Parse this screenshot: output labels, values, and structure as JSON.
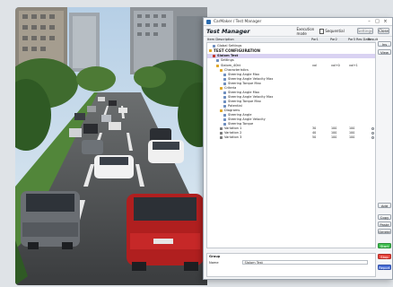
{
  "window": {
    "title": "CarMaker / Test Manager",
    "controls": {
      "minimize": "–",
      "maximize": "□",
      "close": "×"
    }
  },
  "header": {
    "title": "Test Manager",
    "execution_label": "Execution mode",
    "execution_value": "Sequential",
    "settings_label": "Settings",
    "close_label": "Close"
  },
  "columns": [
    "Item Description",
    "Par1",
    "Par2",
    "Par3",
    "Res Date",
    "Result"
  ],
  "tree": [
    {
      "label": "Global Settings",
      "indent": 1,
      "icon": "doc",
      "bold": false
    },
    {
      "label": "TEST CONFIGURATION",
      "indent": 0,
      "icon": "folder",
      "bold": true,
      "big": true
    },
    {
      "label": "Slalom Test",
      "indent": 1,
      "icon": "test",
      "bold": true,
      "selected": true
    },
    {
      "label": "Settings",
      "indent": 2,
      "icon": "doc",
      "bold": false
    },
    {
      "label": "Slalom_40kt",
      "indent": 2,
      "icon": "folder",
      "bold": false,
      "vals": [
        "val",
        "val+0",
        "val+1"
      ]
    },
    {
      "label": "Characteristics",
      "indent": 3,
      "icon": "folder",
      "bold": false
    },
    {
      "label": "Steering Angle Max",
      "indent": 4,
      "icon": "doc",
      "bold": false
    },
    {
      "label": "Steering Angle Velocity Max",
      "indent": 4,
      "icon": "doc",
      "bold": false
    },
    {
      "label": "Steering Torque Max",
      "indent": 4,
      "icon": "doc",
      "bold": false
    },
    {
      "label": "Criteria",
      "indent": 3,
      "icon": "folder",
      "bold": false
    },
    {
      "label": "Steering Angle Max",
      "indent": 4,
      "icon": "doc",
      "bold": false
    },
    {
      "label": "Steering Angle Velocity Max",
      "indent": 4,
      "icon": "doc",
      "bold": false
    },
    {
      "label": "Steering Torque Max",
      "indent": 4,
      "icon": "doc",
      "bold": false
    },
    {
      "label": "Potential",
      "indent": 4,
      "icon": "doc",
      "bold": false
    },
    {
      "label": "Diagrams",
      "indent": 3,
      "icon": "folder",
      "bold": false
    },
    {
      "label": "Steering Angle",
      "indent": 4,
      "icon": "doc",
      "bold": false
    },
    {
      "label": "Steering Angle Velocity",
      "indent": 4,
      "icon": "doc",
      "bold": false
    },
    {
      "label": "Steering Torque",
      "indent": 4,
      "icon": "doc",
      "bold": false
    },
    {
      "label": "Variation 1",
      "indent": 3,
      "icon": "var",
      "bold": false,
      "vals": [
        "30",
        "100",
        "100"
      ],
      "ring": true
    },
    {
      "label": "Variation 2",
      "indent": 3,
      "icon": "var",
      "bold": false,
      "vals": [
        "40",
        "100",
        "100"
      ],
      "ring": true
    },
    {
      "label": "Variation 3",
      "indent": 3,
      "icon": "var",
      "bold": false,
      "vals": [
        "50",
        "100",
        "100"
      ],
      "ring": true
    }
  ],
  "side_buttons": {
    "top": [
      {
        "label": "Ins",
        "name": "insert-button"
      },
      {
        "label": "View",
        "name": "view-button"
      }
    ],
    "middle": [
      {
        "label": "Add",
        "name": "add-button"
      },
      {
        "label": "Copy",
        "name": "copy-button"
      },
      {
        "label": "Paste",
        "name": "paste-button"
      },
      {
        "label": "Delete",
        "name": "delete-button"
      }
    ],
    "bottom": [
      {
        "label": "Start",
        "name": "start-button",
        "color": "#3fbf4f"
      },
      {
        "label": "Stop",
        "name": "stop-button",
        "color": "#e8453c"
      },
      {
        "label": "Report",
        "name": "report-button",
        "color": "#4a6fd8"
      }
    ]
  },
  "group": {
    "title": "Group",
    "name_label": "Name",
    "name_value": "Slalom Test"
  },
  "colors": {
    "selection": "#d9d2f2",
    "folder": "#e0a92b",
    "doc": "#6f8fbf",
    "test": "#c0392b",
    "var": "#7d7d7d"
  }
}
